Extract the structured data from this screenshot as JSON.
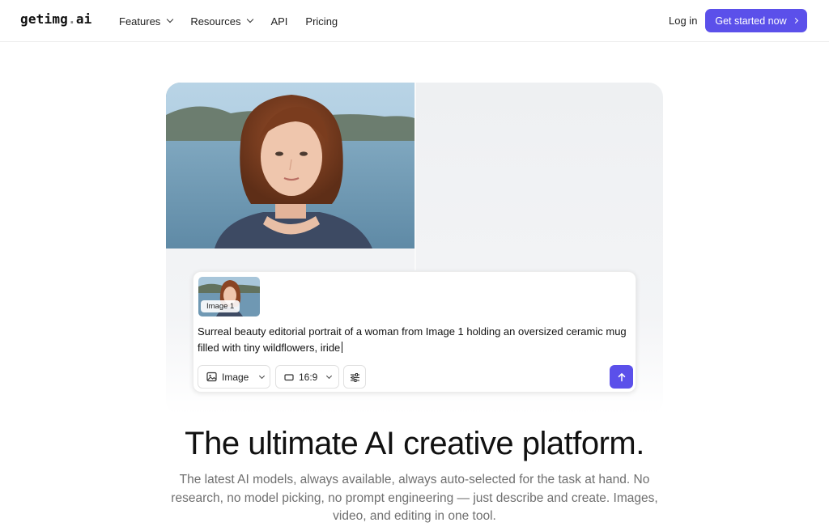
{
  "brand": {
    "name_main": "getimg",
    "name_dot": ".",
    "name_tld": "ai"
  },
  "nav": {
    "features": "Features",
    "resources": "Resources",
    "api": "API",
    "pricing": "Pricing"
  },
  "header": {
    "login": "Log in",
    "cta": "Get started now"
  },
  "prompt": {
    "attachment_label": "Image 1",
    "text": "Surreal beauty editorial portrait of a woman from Image 1 holding an oversized ceramic mug filled with tiny wildflowers, iride",
    "mode_label": "Image",
    "ratio_label": "16:9"
  },
  "hero": {
    "headline": "The ultimate AI creative platform.",
    "subtext": "The latest AI models, always available, always auto-selected for the task at hand. No research, no model picking, no prompt engineering — just describe and create. Images, video, and editing in one tool."
  },
  "colors": {
    "accent": "#5b50ea",
    "text": "#111111",
    "muted": "#6f6f6f"
  }
}
